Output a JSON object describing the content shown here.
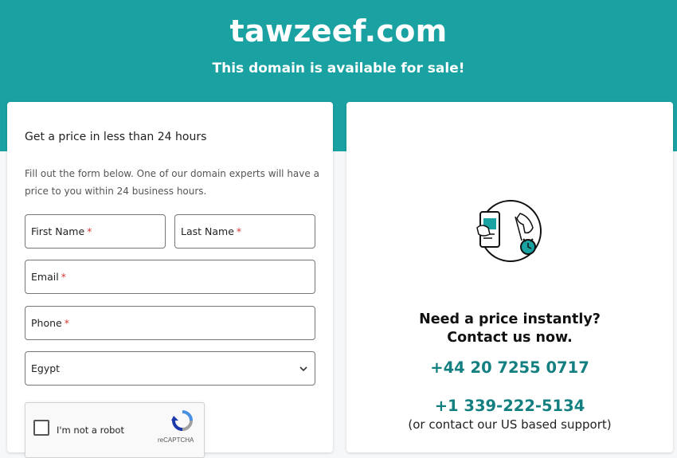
{
  "header": {
    "domain": "tawzeef.com",
    "subtitle": "This domain is available for sale!"
  },
  "form": {
    "heading": "Get a price in less than 24 hours",
    "description": "Fill out the form below. One of our domain experts will have a price to you within 24 business hours.",
    "required_mark": "*",
    "fields": {
      "first_name": "First Name",
      "last_name": "Last Name",
      "email": "Email",
      "phone": "Phone"
    },
    "country": {
      "selected": "Egypt"
    },
    "captcha": {
      "label": "I'm not a robot",
      "brand": "reCAPTCHA"
    }
  },
  "contact": {
    "title_line1": "Need a price instantly?",
    "title_line2": "Contact us now.",
    "phone_uk": "+44 20 7255 0717",
    "phone_us": "+1 339-222-5134",
    "support_note": "(or contact our US based support)"
  },
  "colors": {
    "brand_teal": "#1aa1a2",
    "phone_text": "#137f80",
    "required_red": "#d63838"
  },
  "icons": {
    "chevron": "chevron-down-icon",
    "captcha": "recaptcha-logo-icon",
    "illustration": "phone-hand-clock-illustration"
  }
}
